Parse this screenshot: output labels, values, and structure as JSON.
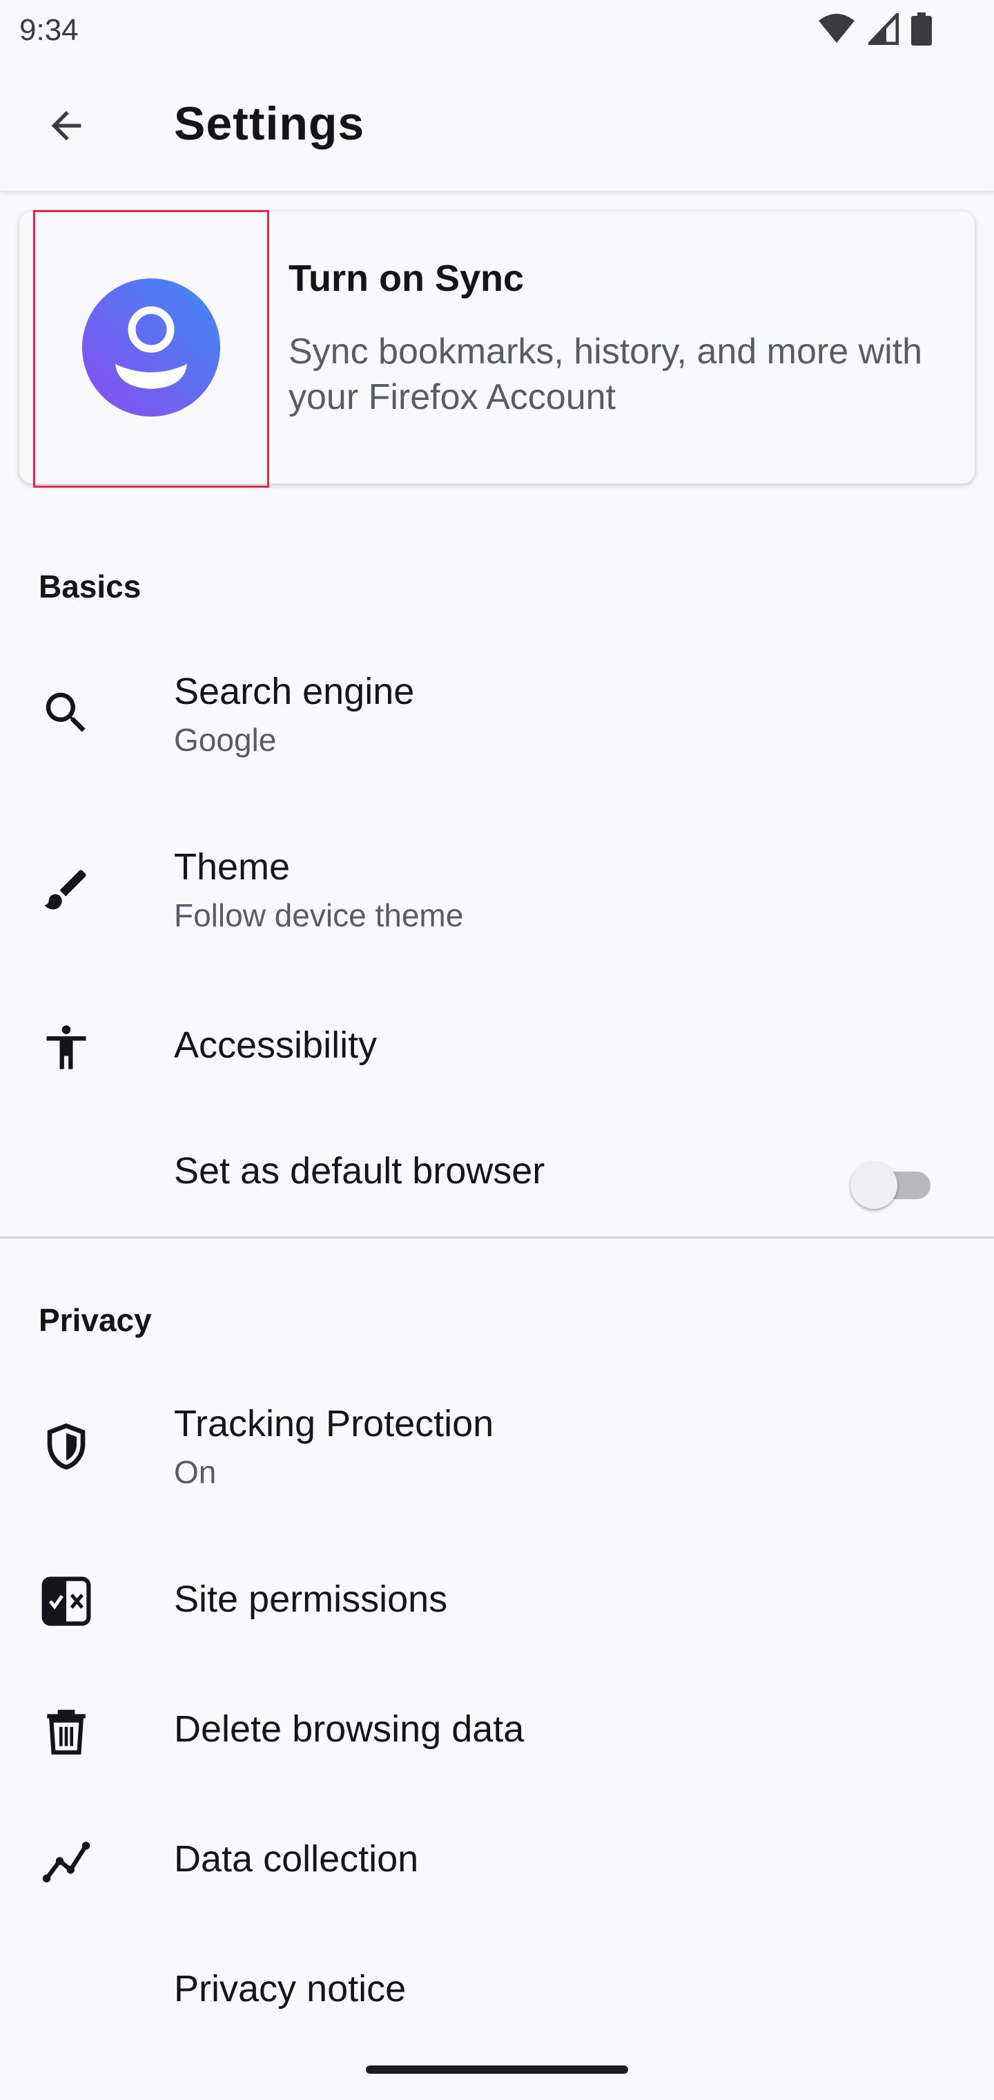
{
  "status_bar": {
    "time": "9:34",
    "icons": [
      "wifi-icon",
      "cell-signal-icon",
      "battery-icon"
    ]
  },
  "app_bar": {
    "back_icon": "arrow-left-icon",
    "title": "Settings"
  },
  "sync_card": {
    "avatar_icon": "account-avatar-icon",
    "title": "Turn on Sync",
    "description": "Sync bookmarks, history, and more with your Firefox Account",
    "avatar_gradient": [
      "#8a4cf0",
      "#3d8bf5"
    ]
  },
  "basics": {
    "header": "Basics",
    "items": [
      {
        "icon": "search-icon",
        "title": "Search engine",
        "subtitle": "Google"
      },
      {
        "icon": "brush-icon",
        "title": "Theme",
        "subtitle": "Follow device theme"
      },
      {
        "icon": "accessibility-icon",
        "title": "Accessibility"
      },
      {
        "title": "Set as default browser",
        "toggle_on": false
      }
    ]
  },
  "privacy": {
    "header": "Privacy",
    "items": [
      {
        "icon": "shield-icon",
        "title": "Tracking Protection",
        "subtitle": "On"
      },
      {
        "icon": "permissions-icon",
        "title": "Site permissions"
      },
      {
        "icon": "trash-icon",
        "title": "Delete browsing data"
      },
      {
        "icon": "data-chart-icon",
        "title": "Data collection"
      },
      {
        "title": "Privacy notice"
      }
    ]
  },
  "colors": {
    "background": "#f9f9fb",
    "text_primary": "#15141a",
    "text_secondary": "#5b5b66",
    "highlight_box": "#e22850"
  }
}
